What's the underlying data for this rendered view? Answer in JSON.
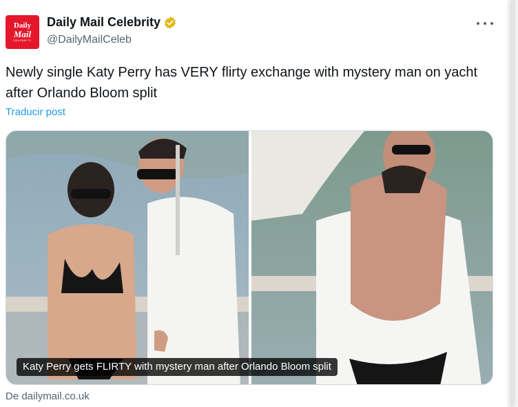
{
  "account": {
    "avatar_line1": "Daily",
    "avatar_line2": "Mail",
    "avatar_line3": "CELEBRITY",
    "display_name": "Daily Mail Celebrity",
    "handle": "@DailyMailCeleb",
    "verified_badge_color": "#e2b719"
  },
  "tweet": {
    "text": "Newly single Katy Perry has VERY flirty exchange with mystery man on yacht after Orlando Bloom split",
    "translate_label": "Traducir post"
  },
  "card": {
    "caption": "Katy Perry gets FLIRTY with mystery man after Orlando Bloom split",
    "source": "De dailymail.co.uk"
  },
  "icons": {
    "more": "more-horizontal-icon",
    "verified": "verified-badge-icon"
  },
  "colors": {
    "link": "#1d9bf0",
    "secondary_text": "#536471",
    "brand_red": "#e4172b"
  }
}
